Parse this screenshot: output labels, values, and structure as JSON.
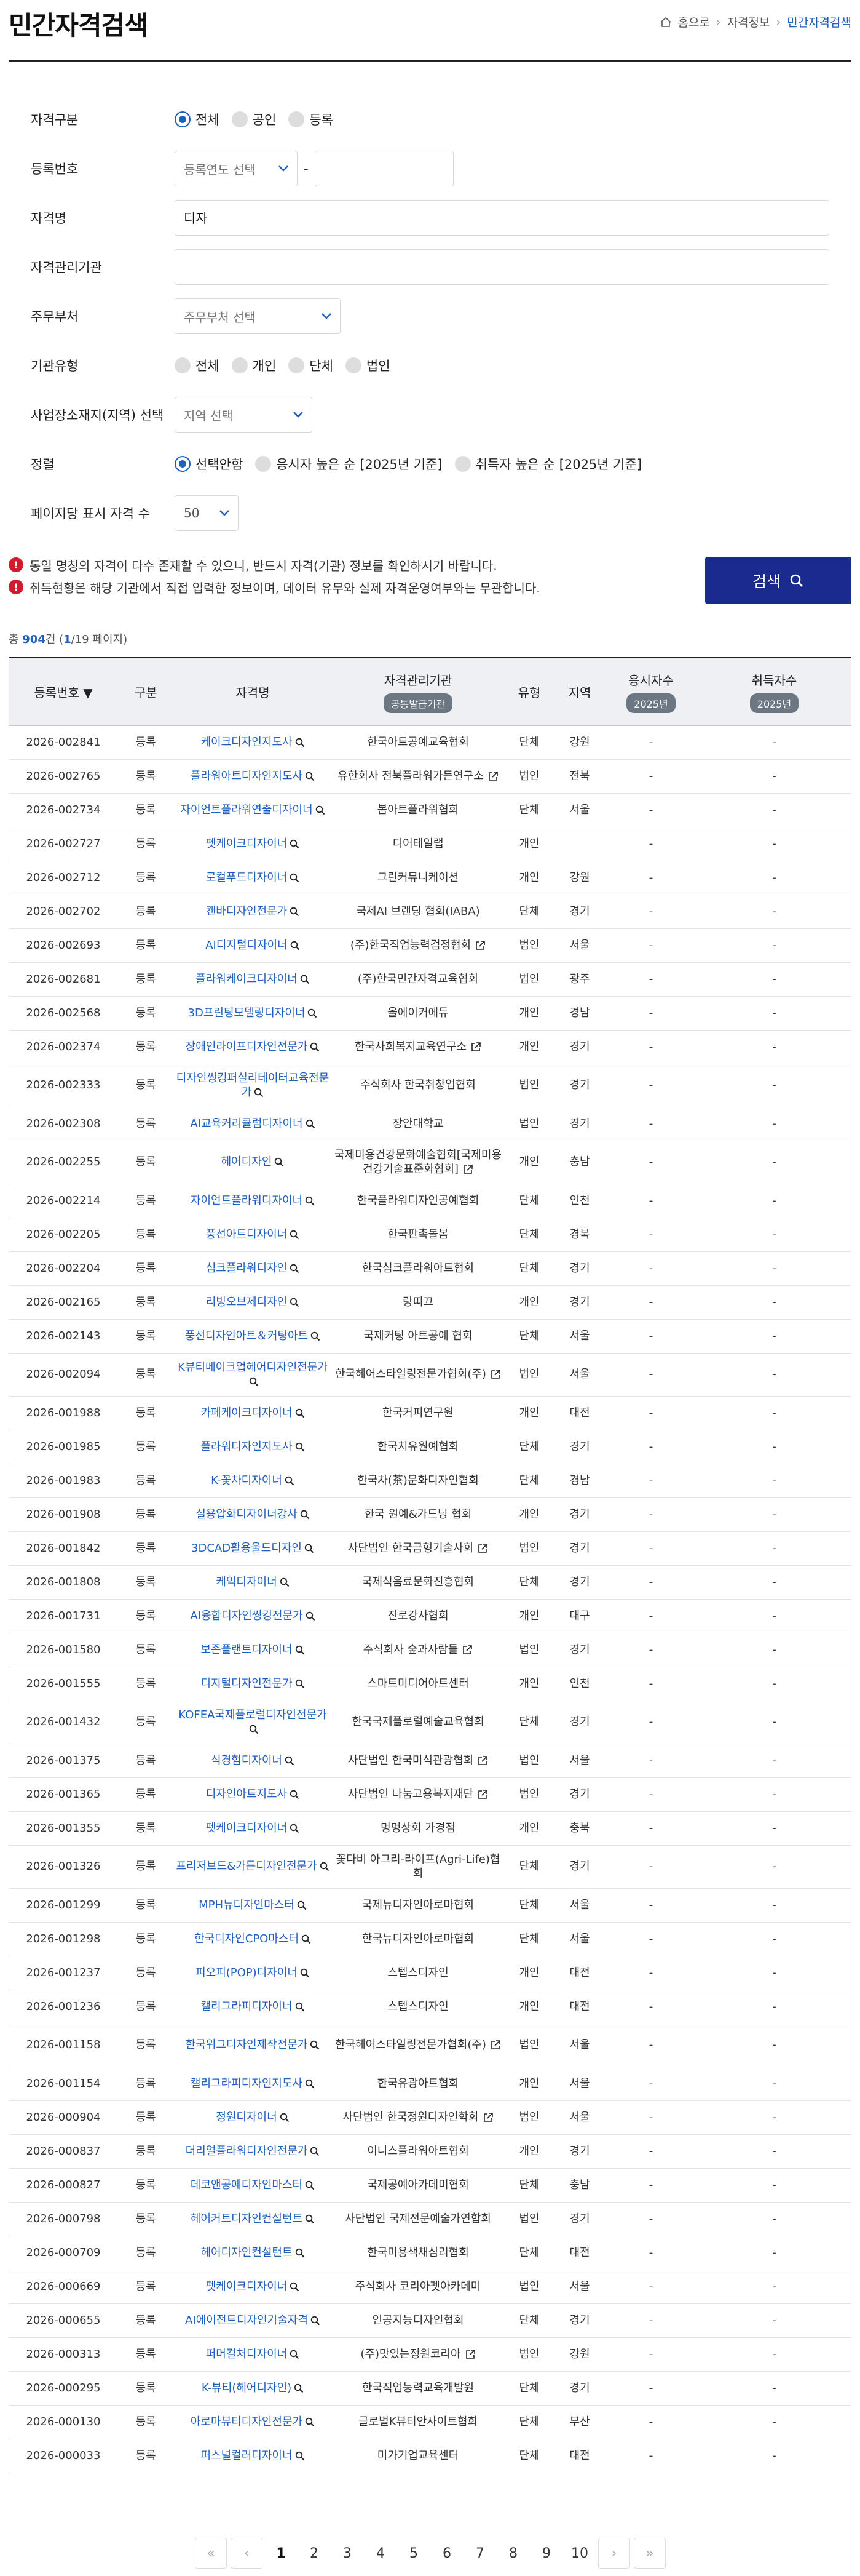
{
  "page_title": "민간자격검색",
  "breadcrumb": {
    "home": "홈으로",
    "mid": "자격정보",
    "current": "민간자격검색"
  },
  "form": {
    "type": {
      "label": "자격구분",
      "options": [
        "전체",
        "공인",
        "등록"
      ],
      "selected": 0
    },
    "reg_no": {
      "label": "등록번호",
      "year_placeholder": "등록연도 선택",
      "dash": "-",
      "no_value": ""
    },
    "name": {
      "label": "자격명",
      "value": "디자"
    },
    "org": {
      "label": "자격관리기관",
      "value": ""
    },
    "ministry": {
      "label": "주무부처",
      "placeholder": "주무부처 선택"
    },
    "org_type": {
      "label": "기관유형",
      "options": [
        "전체",
        "개인",
        "단체",
        "법인"
      ]
    },
    "region": {
      "label": "사업장소재지(지역) 선택",
      "placeholder": "지역 선택"
    },
    "sort": {
      "label": "정렬",
      "options": [
        "선택안함",
        "응시자 높은 순 [2025년 기준]",
        "취득자 높은 순 [2025년 기준]"
      ],
      "selected": 0
    },
    "page_size": {
      "label": "페이지당 표시 자격 수",
      "value": "50"
    }
  },
  "notices": [
    "동일 명칭의 자격이 다수 존재할 수 있으니, 반드시 자격(기관) 정보를 확인하시기 바랍니다.",
    "취득현황은 해당 기관에서 직접 입력한 정보이며, 데이터 유무와 실제 자격운영여부와는 무관합니다."
  ],
  "search_button": "검색",
  "summary": {
    "prefix": "총 ",
    "total": "904",
    "unit": "건 (",
    "page": "1",
    "slash": "/",
    "pages": "19",
    "suffix": " 페이지)"
  },
  "table": {
    "headers": {
      "reg_no": "등록번호 ▼",
      "type": "구분",
      "name": "자격명",
      "org": "자격관리기관",
      "org_sub": "공통발급기관",
      "kind": "유형",
      "region": "지역",
      "applicants": "응시자수",
      "applicants_year": "2025년",
      "acquirers": "취득자수",
      "acquirers_year": "2025년"
    },
    "rows": [
      {
        "reg": "2026-002841",
        "type": "등록",
        "name": "케이크디자인지도사",
        "org": "한국아트공예교육협회",
        "ext": false,
        "kind": "단체",
        "region": "강원",
        "app": "-",
        "acq": "-"
      },
      {
        "reg": "2026-002765",
        "type": "등록",
        "name": "플라워아트디자인지도사",
        "org": "유한회사 전북플라워가든연구소",
        "ext": true,
        "kind": "법인",
        "region": "전북",
        "app": "-",
        "acq": "-"
      },
      {
        "reg": "2026-002734",
        "type": "등록",
        "name": "자이언트플라워연출디자이너",
        "org": "봄아트플라워협회",
        "ext": false,
        "kind": "단체",
        "region": "서울",
        "app": "-",
        "acq": "-"
      },
      {
        "reg": "2026-002727",
        "type": "등록",
        "name": "펫케이크디자이너",
        "org": "디어테일랩",
        "ext": false,
        "kind": "개인",
        "region": "",
        "app": "-",
        "acq": "-"
      },
      {
        "reg": "2026-002712",
        "type": "등록",
        "name": "로컬푸드디자이너",
        "org": "그린커뮤니케이션",
        "ext": false,
        "kind": "개인",
        "region": "강원",
        "app": "-",
        "acq": "-"
      },
      {
        "reg": "2026-002702",
        "type": "등록",
        "name": "캔바디자인전문가",
        "org": "국제AI 브랜딩 협회(IABA)",
        "ext": false,
        "kind": "단체",
        "region": "경기",
        "app": "-",
        "acq": "-"
      },
      {
        "reg": "2026-002693",
        "type": "등록",
        "name": "AI디지털디자이너",
        "org": "(주)한국직업능력검정협회",
        "ext": true,
        "kind": "법인",
        "region": "서울",
        "app": "-",
        "acq": "-"
      },
      {
        "reg": "2026-002681",
        "type": "등록",
        "name": "플라워케이크디자이너",
        "org": "(주)한국민간자격교육협회",
        "ext": false,
        "kind": "법인",
        "region": "광주",
        "app": "-",
        "acq": "-"
      },
      {
        "reg": "2026-002568",
        "type": "등록",
        "name": "3D프린팅모델링디자이너",
        "org": "올에이커에듀",
        "ext": false,
        "kind": "개인",
        "region": "경남",
        "app": "-",
        "acq": "-"
      },
      {
        "reg": "2026-002374",
        "type": "등록",
        "name": "장애인라이프디자인전문가",
        "org": "한국사회복지교육연구소",
        "ext": true,
        "kind": "개인",
        "region": "경기",
        "app": "-",
        "acq": "-"
      },
      {
        "reg": "2026-002333",
        "type": "등록",
        "name": "디자인씽킹퍼실리테이터교육전문가",
        "org": "주식회사 한국취창업협회",
        "ext": false,
        "kind": "법인",
        "region": "경기",
        "app": "-",
        "acq": "-"
      },
      {
        "reg": "2026-002308",
        "type": "등록",
        "name": "AI교육커리큘럼디자이너",
        "org": "장안대학교",
        "ext": false,
        "kind": "법인",
        "region": "경기",
        "app": "-",
        "acq": "-"
      },
      {
        "reg": "2026-002255",
        "type": "등록",
        "name": "헤어디자인",
        "org": "국제미용건강문화예술협회[국제미용건강기술표준화협회]",
        "ext": true,
        "kind": "개인",
        "region": "충남",
        "app": "-",
        "acq": "-"
      },
      {
        "reg": "2026-002214",
        "type": "등록",
        "name": "자이언트플라워디자이너",
        "org": "한국플라워디자인공예협회",
        "ext": false,
        "kind": "단체",
        "region": "인천",
        "app": "-",
        "acq": "-"
      },
      {
        "reg": "2026-002205",
        "type": "등록",
        "name": "풍선아트디자이너",
        "org": "한국판촉돌봄",
        "ext": false,
        "kind": "단체",
        "region": "경북",
        "app": "-",
        "acq": "-"
      },
      {
        "reg": "2026-002204",
        "type": "등록",
        "name": "심크플라워디자인",
        "org": "한국심크플라워아트협회",
        "ext": false,
        "kind": "단체",
        "region": "경기",
        "app": "-",
        "acq": "-"
      },
      {
        "reg": "2026-002165",
        "type": "등록",
        "name": "리빙오브제디자인",
        "org": "랑띠끄",
        "ext": false,
        "kind": "개인",
        "region": "경기",
        "app": "-",
        "acq": "-"
      },
      {
        "reg": "2026-002143",
        "type": "등록",
        "name": "풍선디자인아트＆커팅아트",
        "org": "국제커팅 아트공예 협회",
        "ext": false,
        "kind": "단체",
        "region": "서울",
        "app": "-",
        "acq": "-"
      },
      {
        "reg": "2026-002094",
        "type": "등록",
        "name": "K뷰티메이크업헤어디자인전문가",
        "org": "한국헤어스타일링전문가협회(주)",
        "ext": true,
        "kind": "법인",
        "region": "서울",
        "app": "-",
        "acq": "-"
      },
      {
        "reg": "2026-001988",
        "type": "등록",
        "name": "카페케이크디자이너",
        "org": "한국커피연구원",
        "ext": false,
        "kind": "개인",
        "region": "대전",
        "app": "-",
        "acq": "-"
      },
      {
        "reg": "2026-001985",
        "type": "등록",
        "name": "플라워디자인지도사",
        "org": "한국치유원예협회",
        "ext": false,
        "kind": "단체",
        "region": "경기",
        "app": "-",
        "acq": "-"
      },
      {
        "reg": "2026-001983",
        "type": "등록",
        "name": "K-꽃차디자이너",
        "org": "한국차(茶)문화디자인협회",
        "ext": false,
        "kind": "단체",
        "region": "경남",
        "app": "-",
        "acq": "-"
      },
      {
        "reg": "2026-001908",
        "type": "등록",
        "name": "실용압화디자이너강사",
        "org": "한국 원예&가드닝 협회",
        "ext": false,
        "kind": "개인",
        "region": "경기",
        "app": "-",
        "acq": "-"
      },
      {
        "reg": "2026-001842",
        "type": "등록",
        "name": "3DCAD활용울드디자인",
        "org": "사단법인 한국금형기술사회",
        "ext": true,
        "kind": "법인",
        "region": "경기",
        "app": "-",
        "acq": "-"
      },
      {
        "reg": "2026-001808",
        "type": "등록",
        "name": "케익디자이너",
        "org": "국제식음료문화진흥협회",
        "ext": false,
        "kind": "단체",
        "region": "경기",
        "app": "-",
        "acq": "-"
      },
      {
        "reg": "2026-001731",
        "type": "등록",
        "name": "AI융합디자인씽킹전문가",
        "org": "진로강사협회",
        "ext": false,
        "kind": "개인",
        "region": "대구",
        "app": "-",
        "acq": "-"
      },
      {
        "reg": "2026-001580",
        "type": "등록",
        "name": "보존플랜트디자이너",
        "org": "주식회사 숲과사람들",
        "ext": true,
        "kind": "법인",
        "region": "경기",
        "app": "-",
        "acq": "-"
      },
      {
        "reg": "2026-001555",
        "type": "등록",
        "name": "디지털디자인전문가",
        "org": "스마트미디어아트센터",
        "ext": false,
        "kind": "개인",
        "region": "인천",
        "app": "-",
        "acq": "-"
      },
      {
        "reg": "2026-001432",
        "type": "등록",
        "name": "KOFEA국제플로럴디자인전문가",
        "org": "한국국제플로럴예술교육협회",
        "ext": false,
        "kind": "단체",
        "region": "경기",
        "app": "-",
        "acq": "-"
      },
      {
        "reg": "2026-001375",
        "type": "등록",
        "name": "식경험디자이너",
        "org": "사단법인 한국미식관광협회",
        "ext": true,
        "kind": "법인",
        "region": "서울",
        "app": "-",
        "acq": "-"
      },
      {
        "reg": "2026-001365",
        "type": "등록",
        "name": "디자인아트지도사",
        "org": "사단법인 나눔고용복지재단",
        "ext": true,
        "kind": "법인",
        "region": "경기",
        "app": "-",
        "acq": "-"
      },
      {
        "reg": "2026-001355",
        "type": "등록",
        "name": "펫케이크디자이너",
        "org": "멍멍상회 가경점",
        "ext": false,
        "kind": "개인",
        "region": "충북",
        "app": "-",
        "acq": "-"
      },
      {
        "reg": "2026-001326",
        "type": "등록",
        "name": "프리저브드&가든디자인전문가",
        "org": "꽃다비 아그리-라이프(Agri-Life)협회",
        "ext": false,
        "kind": "단체",
        "region": "경기",
        "app": "-",
        "acq": "-"
      },
      {
        "reg": "2026-001299",
        "type": "등록",
        "name": "MPH뉴디자인마스터",
        "org": "국제뉴디자인아로마협회",
        "ext": false,
        "kind": "단체",
        "region": "서울",
        "app": "-",
        "acq": "-"
      },
      {
        "reg": "2026-001298",
        "type": "등록",
        "name": "한국디자인CPO마스터",
        "org": "한국뉴디자인아로마협회",
        "ext": false,
        "kind": "단체",
        "region": "서울",
        "app": "-",
        "acq": "-"
      },
      {
        "reg": "2026-001237",
        "type": "등록",
        "name": "피오피(POP)디자이너",
        "org": "스텝스디자인",
        "ext": false,
        "kind": "개인",
        "region": "대전",
        "app": "-",
        "acq": "-"
      },
      {
        "reg": "2026-001236",
        "type": "등록",
        "name": "캘리그라피디자이너",
        "org": "스텝스디자인",
        "ext": false,
        "kind": "개인",
        "region": "대전",
        "app": "-",
        "acq": "-"
      },
      {
        "reg": "2026-001158",
        "type": "등록",
        "name": "한국위그디자인제작전문가",
        "org": "한국헤어스타일링전문가협회(주)",
        "ext": true,
        "kind": "법인",
        "region": "서울",
        "app": "-",
        "acq": "-"
      },
      {
        "reg": "2026-001154",
        "type": "등록",
        "name": "캘리그라피디자인지도사",
        "org": "한국유광아트협회",
        "ext": false,
        "kind": "개인",
        "region": "서울",
        "app": "-",
        "acq": "-"
      },
      {
        "reg": "2026-000904",
        "type": "등록",
        "name": "정원디자이너",
        "org": "사단법인 한국정원디자인학회",
        "ext": true,
        "kind": "법인",
        "region": "서울",
        "app": "-",
        "acq": "-"
      },
      {
        "reg": "2026-000837",
        "type": "등록",
        "name": "더리얼플라워디자인전문가",
        "org": "이니스플라워아트협회",
        "ext": false,
        "kind": "개인",
        "region": "경기",
        "app": "-",
        "acq": "-"
      },
      {
        "reg": "2026-000827",
        "type": "등록",
        "name": "데코앤공예디자인마스터",
        "org": "국제공예아카데미협회",
        "ext": false,
        "kind": "단체",
        "region": "충남",
        "app": "-",
        "acq": "-"
      },
      {
        "reg": "2026-000798",
        "type": "등록",
        "name": "헤어커트디자인컨설턴트",
        "org": "사단법인 국제전문예술가연합회",
        "ext": false,
        "kind": "법인",
        "region": "경기",
        "app": "-",
        "acq": "-"
      },
      {
        "reg": "2026-000709",
        "type": "등록",
        "name": "헤어디자인컨설턴트",
        "org": "한국미용색채심리협회",
        "ext": false,
        "kind": "단체",
        "region": "대전",
        "app": "-",
        "acq": "-"
      },
      {
        "reg": "2026-000669",
        "type": "등록",
        "name": "펫케이크디자이너",
        "org": "주식회사 코리아펫아카데미",
        "ext": false,
        "kind": "법인",
        "region": "서울",
        "app": "-",
        "acq": "-"
      },
      {
        "reg": "2026-000655",
        "type": "등록",
        "name": "AI에이전트디자인기술자격",
        "org": "인공지능디자인협회",
        "ext": false,
        "kind": "단체",
        "region": "경기",
        "app": "-",
        "acq": "-"
      },
      {
        "reg": "2026-000313",
        "type": "등록",
        "name": "퍼머컬처디자이너",
        "org": "(주)맛있는정원코리아",
        "ext": true,
        "kind": "법인",
        "region": "강원",
        "app": "-",
        "acq": "-"
      },
      {
        "reg": "2026-000295",
        "type": "등록",
        "name": "K-뷰티(헤어디자인)",
        "org": "한국직업능력교육개발원",
        "ext": false,
        "kind": "단체",
        "region": "경기",
        "app": "-",
        "acq": "-"
      },
      {
        "reg": "2026-000130",
        "type": "등록",
        "name": "아로마뷰티디자인전문가",
        "org": "글로벌K뷰티안사이트협회",
        "ext": false,
        "kind": "단체",
        "region": "부산",
        "app": "-",
        "acq": "-"
      },
      {
        "reg": "2026-000033",
        "type": "등록",
        "name": "퍼스널컬러디자이너",
        "org": "미가기업교육센터",
        "ext": false,
        "kind": "단체",
        "region": "대전",
        "app": "-",
        "acq": "-"
      }
    ]
  },
  "pager": {
    "first": "«",
    "prev": "‹",
    "pages": [
      "1",
      "2",
      "3",
      "4",
      "5",
      "6",
      "7",
      "8",
      "9",
      "10"
    ],
    "current": "1",
    "next": "›",
    "last": "»"
  },
  "colors": {
    "accent": "#1f5fbf",
    "button": "#1a2a8f",
    "alert": "#d41b2c"
  }
}
